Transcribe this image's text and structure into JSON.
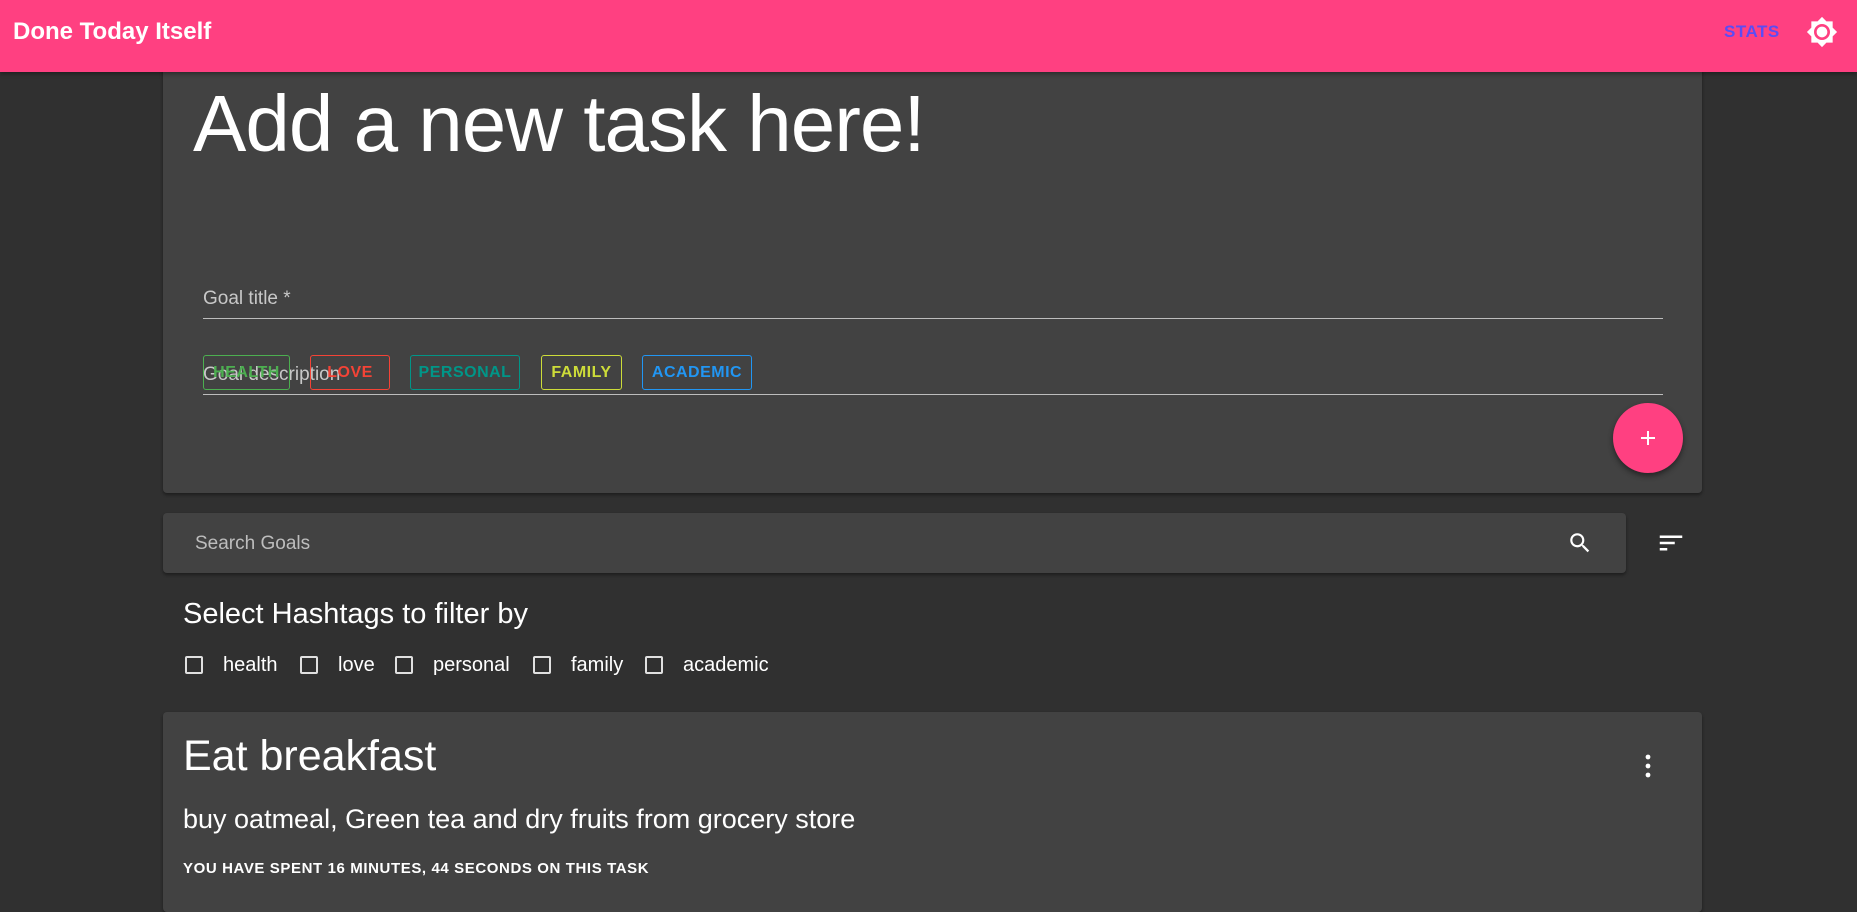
{
  "appbar": {
    "title": "Done Today Itself",
    "stats_label": "STATS",
    "theme_icon": "brightness-icon",
    "color": "#ff4081"
  },
  "new_task": {
    "heading": "Add a new task here!",
    "title_placeholder": "Goal title *",
    "description_placeholder": "Goal description",
    "tags": [
      {
        "label": "HEALTH",
        "color": "#4caf50"
      },
      {
        "label": "LOVE",
        "color": "#f44336"
      },
      {
        "label": "PERSONAL",
        "color": "#009688"
      },
      {
        "label": "FAMILY",
        "color": "#cddc39"
      },
      {
        "label": "ACADEMIC",
        "color": "#2196f3"
      }
    ],
    "add_icon": "plus-icon"
  },
  "search": {
    "placeholder": "Search Goals",
    "search_icon": "search-icon",
    "sort_icon": "sort-icon"
  },
  "filter": {
    "heading": "Select Hashtags to filter by",
    "options": [
      {
        "label": "health",
        "checked": false
      },
      {
        "label": "love",
        "checked": false
      },
      {
        "label": "personal",
        "checked": false
      },
      {
        "label": "family",
        "checked": false
      },
      {
        "label": "academic",
        "checked": false
      }
    ]
  },
  "tasks": [
    {
      "title": "Eat breakfast",
      "description": "buy oatmeal, Green tea and dry fruits from grocery store",
      "time_spent": "YOU HAVE SPENT 16 MINUTES, 44 SECONDS ON THIS TASK",
      "menu_icon": "more-vert-icon"
    }
  ]
}
